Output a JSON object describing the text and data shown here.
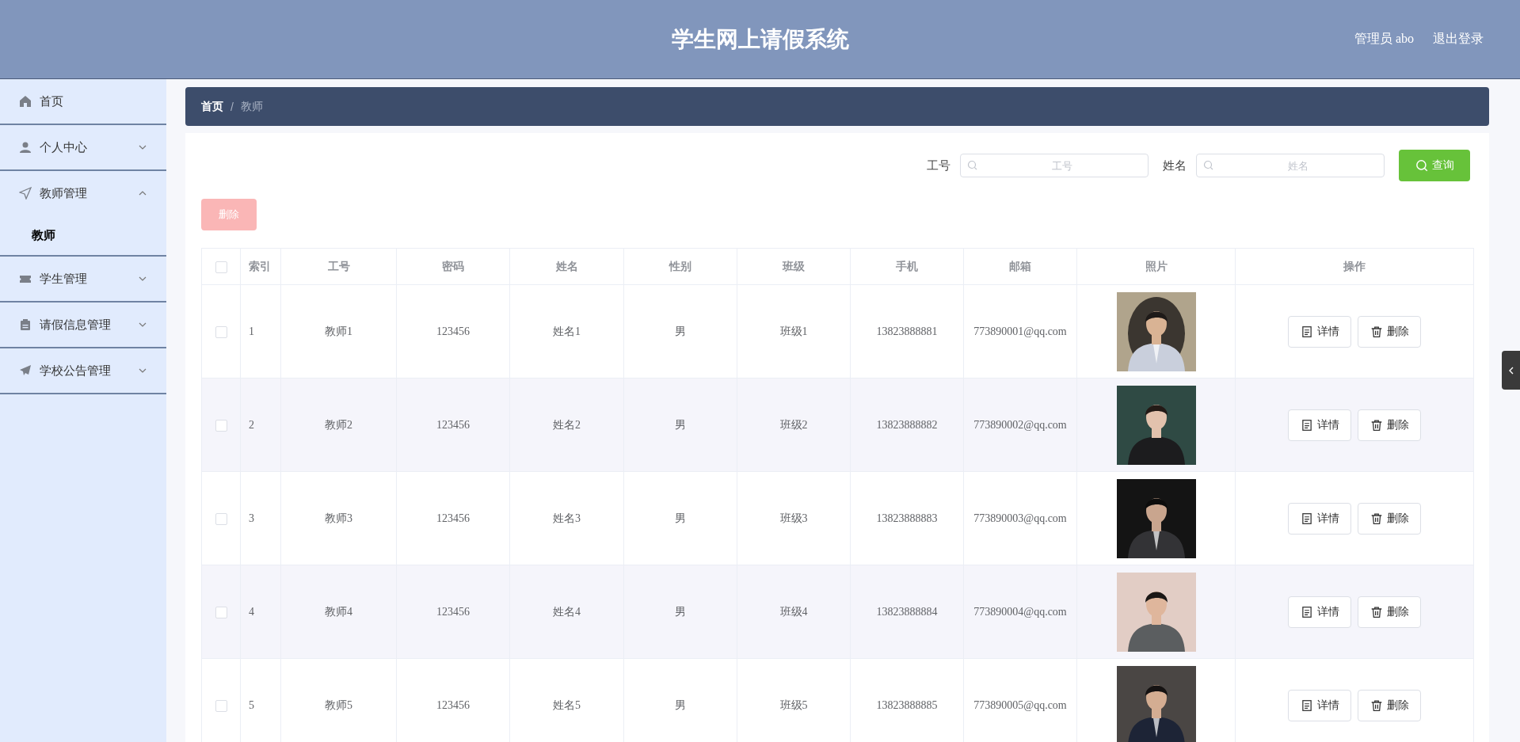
{
  "header": {
    "title": "学生网上请假系统",
    "user": "管理员 abo",
    "logout": "退出登录"
  },
  "sidebar": {
    "items": [
      {
        "label": "首页",
        "expandable": false
      },
      {
        "label": "个人中心",
        "expandable": true,
        "expanded": false
      },
      {
        "label": "教师管理",
        "expandable": true,
        "expanded": true,
        "children": [
          {
            "label": "教师",
            "selected": true
          }
        ]
      },
      {
        "label": "学生管理",
        "expandable": true,
        "expanded": false
      },
      {
        "label": "请假信息管理",
        "expandable": true,
        "expanded": false
      },
      {
        "label": "学校公告管理",
        "expandable": true,
        "expanded": false
      }
    ]
  },
  "breadcrumb": {
    "separator": "/",
    "items": [
      {
        "label": "首页",
        "current": false
      },
      {
        "label": "教师",
        "current": true
      }
    ]
  },
  "search": {
    "fields": [
      {
        "label": "工号",
        "placeholder": "工号"
      },
      {
        "label": "姓名",
        "placeholder": "姓名"
      }
    ],
    "button": "查询"
  },
  "delete_button": {
    "label": "删除",
    "disabled": true
  },
  "table": {
    "select_all_checked": false,
    "columns": [
      "索引",
      "工号",
      "密码",
      "姓名",
      "性别",
      "班级",
      "手机",
      "邮箱",
      "照片",
      "操作"
    ],
    "rows": [
      {
        "checked": false,
        "index": "1",
        "id": "教师1",
        "password": "123456",
        "name": "姓名1",
        "gender": "男",
        "class": "班级1",
        "phone": "13823888881",
        "email": "773890001@qq.com",
        "actions": [
          "详情",
          "删除"
        ]
      },
      {
        "checked": false,
        "index": "2",
        "id": "教师2",
        "password": "123456",
        "name": "姓名2",
        "gender": "男",
        "class": "班级2",
        "phone": "13823888882",
        "email": "773890002@qq.com",
        "actions": [
          "详情",
          "删除"
        ]
      },
      {
        "checked": false,
        "index": "3",
        "id": "教师3",
        "password": "123456",
        "name": "姓名3",
        "gender": "男",
        "class": "班级3",
        "phone": "13823888883",
        "email": "773890003@qq.com",
        "actions": [
          "详情",
          "删除"
        ]
      },
      {
        "checked": false,
        "index": "4",
        "id": "教师4",
        "password": "123456",
        "name": "姓名4",
        "gender": "男",
        "class": "班级4",
        "phone": "13823888884",
        "email": "773890004@qq.com",
        "actions": [
          "详情",
          "删除"
        ]
      },
      {
        "checked": false,
        "index": "5",
        "id": "教师5",
        "password": "123456",
        "name": "姓名5",
        "gender": "男",
        "class": "班级5",
        "phone": "13823888885",
        "email": "773890005@qq.com",
        "actions": [
          "详情",
          "删除"
        ]
      }
    ]
  }
}
